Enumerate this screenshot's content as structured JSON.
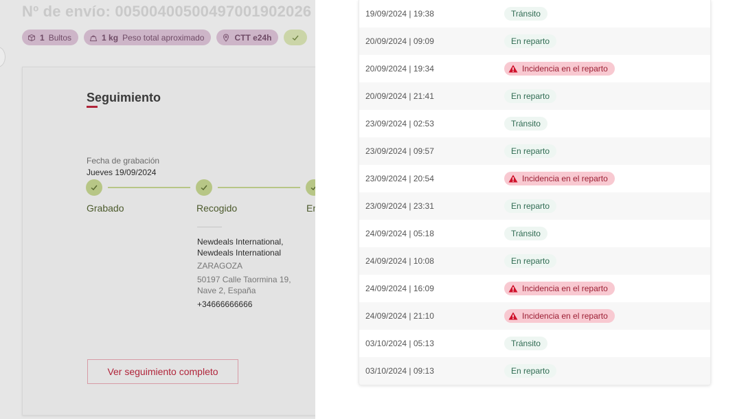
{
  "background_page": {
    "shipment_title": "Nº de envío: 00500400500497001902026",
    "badges": [
      {
        "icon": "box-icon",
        "value": "1",
        "label": "Bultos"
      },
      {
        "icon": "weight-icon",
        "value": "1 kg",
        "label": "Peso total aproximado"
      },
      {
        "icon": "location-pin-icon",
        "value": "CTT e24h",
        "label": ""
      },
      {
        "icon": "check-icon",
        "value": "",
        "label": ""
      }
    ],
    "tracking_card": {
      "title": "Seguimiento",
      "record_label": "Fecha de grabación",
      "record_date": "Jueves 19/09/2024",
      "steps": [
        "Grabado",
        "Recogido",
        "En"
      ],
      "pickup": {
        "company_line1": "Newdeals International,",
        "company_line2": "Newdeals International",
        "city": "ZARAGOZA",
        "address_line1": "50197 Calle Taormina 19,",
        "address_line2": "Nave 2, España",
        "phone": "+34666666666"
      },
      "full_tracking_button": "Ver seguimiento completo"
    }
  },
  "events_panel": {
    "status_colors": {
      "transit_bg": "#eef6f2",
      "transit_text": "#2f6b52",
      "incident_bg": "#f8c9d1",
      "incident_text": "#9b1e33",
      "incident_icon": "#d0112b"
    },
    "events": [
      {
        "datetime": "19/09/2024 | 19:38",
        "status": "Tránsito",
        "type": "transit"
      },
      {
        "datetime": "20/09/2024 | 09:09",
        "status": "En reparto",
        "type": "delivery"
      },
      {
        "datetime": "20/09/2024 | 19:34",
        "status": "Incidencia en el reparto",
        "type": "incident"
      },
      {
        "datetime": "20/09/2024 | 21:41",
        "status": "En reparto",
        "type": "delivery"
      },
      {
        "datetime": "23/09/2024 | 02:53",
        "status": "Tránsito",
        "type": "transit"
      },
      {
        "datetime": "23/09/2024 | 09:57",
        "status": "En reparto",
        "type": "delivery"
      },
      {
        "datetime": "23/09/2024 | 20:54",
        "status": "Incidencia en el reparto",
        "type": "incident"
      },
      {
        "datetime": "23/09/2024 | 23:31",
        "status": "En reparto",
        "type": "delivery"
      },
      {
        "datetime": "24/09/2024 | 05:18",
        "status": "Tránsito",
        "type": "transit"
      },
      {
        "datetime": "24/09/2024 | 10:08",
        "status": "En reparto",
        "type": "delivery"
      },
      {
        "datetime": "24/09/2024 | 16:09",
        "status": "Incidencia en el reparto",
        "type": "incident"
      },
      {
        "datetime": "24/09/2024 | 21:10",
        "status": "Incidencia en el reparto",
        "type": "incident"
      },
      {
        "datetime": "03/10/2024 | 05:13",
        "status": "Tránsito",
        "type": "transit"
      },
      {
        "datetime": "03/10/2024 | 09:13",
        "status": "En reparto",
        "type": "delivery"
      }
    ]
  }
}
